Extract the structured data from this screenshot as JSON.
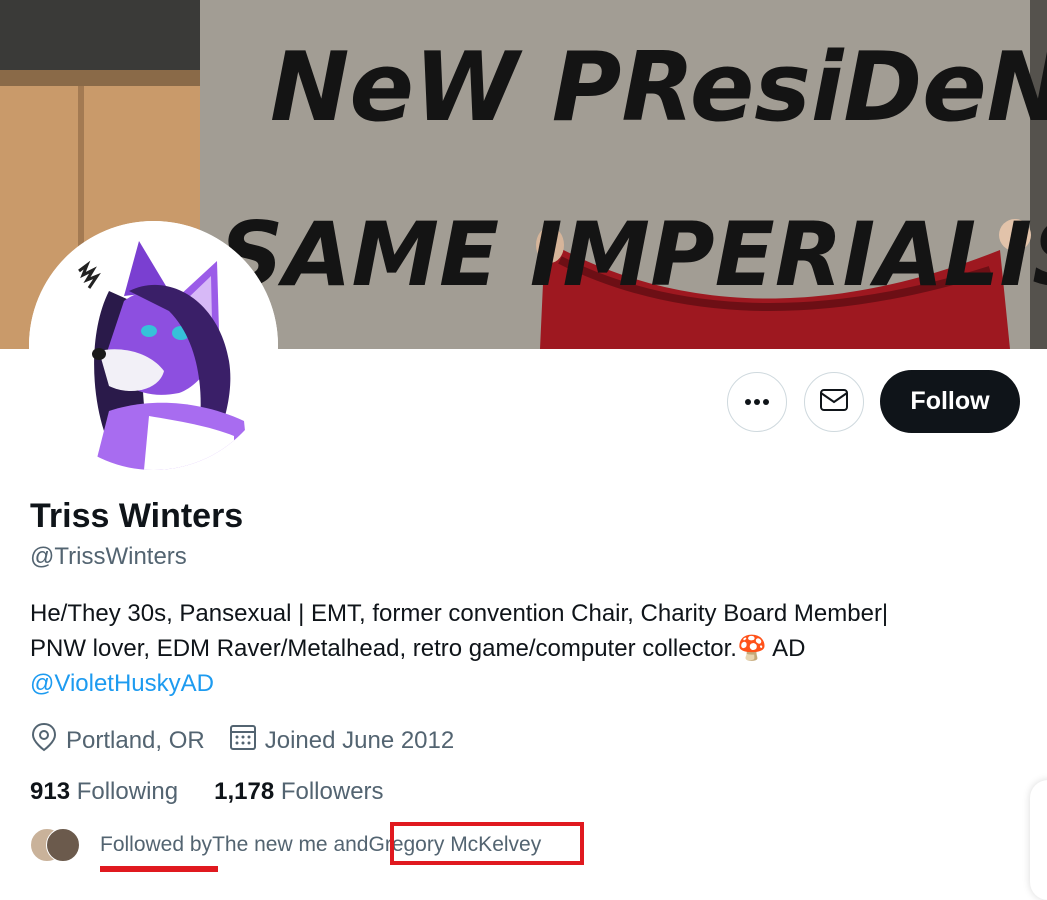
{
  "profile": {
    "display_name": "Triss Winters",
    "handle": "@TrissWinters",
    "bio_line1": "He/They 30s, Pansexual | EMT, former convention Chair, Charity Board Member|",
    "bio_line2_text": "PNW lover, EDM Raver/Metalhead, retro game/computer collector.",
    "bio_line2_emoji": "🍄",
    "bio_line2_suffix": " AD",
    "bio_mention": "@VioletHuskyAD",
    "location": "Portland, OR",
    "joined": "Joined June 2012"
  },
  "banner": {
    "graffiti_line1": "NeW PResiDeNT",
    "graffiti_line2": "SAME IMPERIALISM"
  },
  "actions": {
    "more_icon": "more-horizontal-icon",
    "message_icon": "envelope-icon",
    "follow_label": "Follow"
  },
  "stats": {
    "following_count": "913",
    "following_label": "Following",
    "followers_count": "1,178",
    "followers_label": "Followers"
  },
  "followed_by": {
    "prefix": "Followed by",
    "middle": " The new me and ",
    "last_name": "Gregory McKelvey"
  },
  "colors": {
    "accent": "#1d9bf0",
    "follow_button": "#0f1419",
    "annotation_red": "#e0191f",
    "secondary_text": "#536471"
  }
}
